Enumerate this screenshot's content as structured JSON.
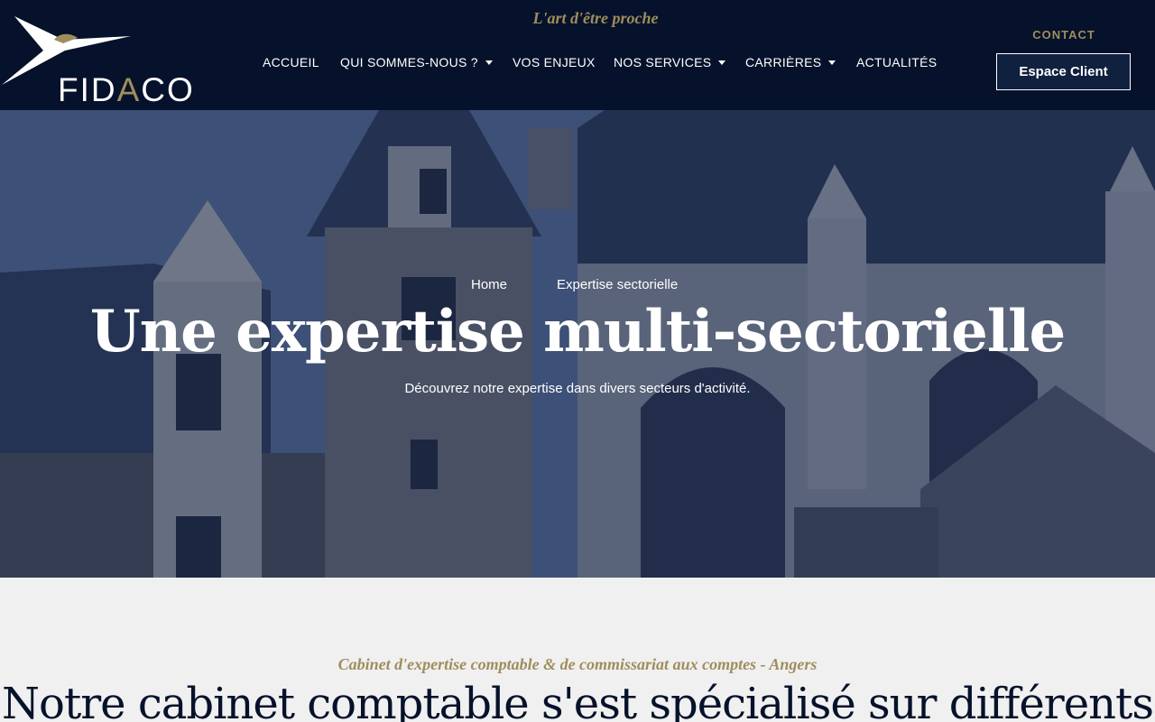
{
  "header": {
    "brand": {
      "prefix": "FID",
      "accent": "A",
      "suffix": "CO"
    },
    "tagline": "L'art d'être proche",
    "nav": [
      {
        "label": "ACCUEIL",
        "has_dropdown": false
      },
      {
        "label": "QUI SOMMES-NOUS ?",
        "has_dropdown": true
      },
      {
        "label": "VOS ENJEUX",
        "has_dropdown": false
      },
      {
        "label": "NOS SERVICES",
        "has_dropdown": true
      },
      {
        "label": "CARRIÈRES",
        "has_dropdown": true
      },
      {
        "label": "ACTUALITÉS",
        "has_dropdown": false
      }
    ],
    "contact_label": "CONTACT",
    "client_button_label": "Espace Client"
  },
  "hero": {
    "breadcrumb": [
      "Home",
      "Expertise sectorielle"
    ],
    "title": "Une expertise multi-sectorielle",
    "subtitle": "Découvrez notre expertise dans divers secteurs d'activité."
  },
  "section": {
    "kicker": "Cabinet d'expertise comptable & de commissariat aux comptes - Angers",
    "title": "Notre cabinet comptable s'est spécialisé sur différents"
  },
  "colors": {
    "navy": "#06122b",
    "gold": "#a08d5d",
    "light_bg": "#f0f0f0"
  },
  "icons": {
    "logo_mark": "swoosh-logo-icon",
    "dropdown": "caret-down-icon"
  }
}
